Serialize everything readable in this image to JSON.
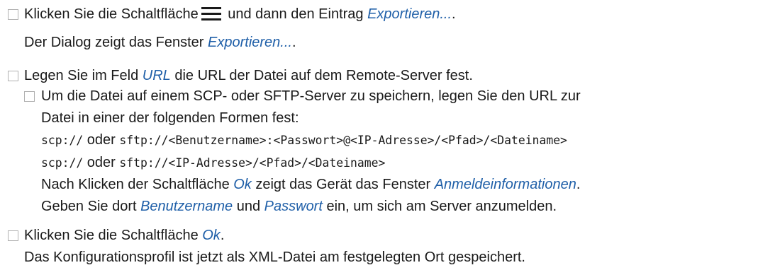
{
  "step1": {
    "line1_prefix": "Klicken Sie die Schaltfläche",
    "line1_middle": " und dann den Eintrag ",
    "line1_link": "Exportieren...",
    "line1_end": ".",
    "line2_prefix": "Der Dialog zeigt das Fenster ",
    "line2_link": "Exportieren...",
    "line2_end": ".",
    "icon": "hamburger-menu-icon"
  },
  "step2": {
    "prefix": "Legen Sie im Feld ",
    "field": "URL",
    "suffix": " die URL der Datei auf dem Remote-Server fest.",
    "sub": {
      "line1": "Um die Datei auf einem SCP- oder SFTP-Server zu speichern, legen Sie den URL zur",
      "line2": "Datei in einer der folgenden Formen fest:",
      "form1_a": "scp://",
      "form1_or": " oder ",
      "form1_b": "sftp://<Benutzername>:<Passwort>@<IP-Adresse>/<Pfad>/<Dateiname>",
      "form2_a": "scp://",
      "form2_or": " oder ",
      "form2_b": "sftp://<IP-Adresse>/<Pfad>/<Dateiname>",
      "after1_prefix": "Nach Klicken der Schaltfläche ",
      "after1_ok": "Ok",
      "after1_mid": " zeigt das Gerät das Fenster ",
      "after1_win": "Anmeldeinformationen",
      "after1_end": ".",
      "after2_prefix": "Geben Sie dort ",
      "after2_user": "Benutzername",
      "after2_and": " und ",
      "after2_pass": "Passwort",
      "after2_end": " ein, um sich am Server anzumelden."
    }
  },
  "step3": {
    "prefix": "Klicken Sie die Schaltfläche ",
    "ok": "Ok",
    "end": ".",
    "result": "Das Konfigurationsprofil ist jetzt als XML-Datei am festgelegten Ort gespeichert."
  }
}
